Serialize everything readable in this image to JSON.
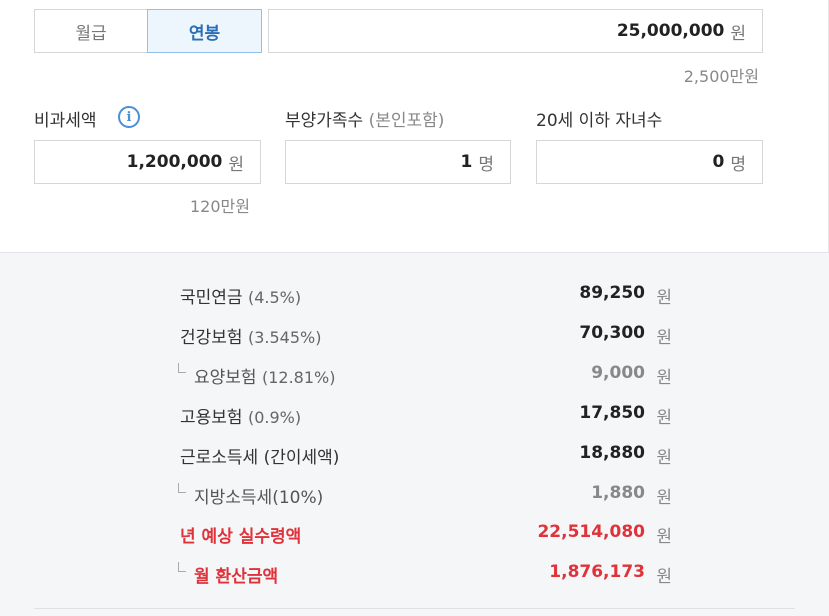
{
  "pay_type_tabs": [
    {
      "label": "월급",
      "selected": false
    },
    {
      "label": "연봉",
      "selected": true
    }
  ],
  "salary": {
    "value": "25,000,000",
    "unit": "원",
    "hint": "2,500만원"
  },
  "nontax": {
    "label": "비과세액",
    "info_icon": "info-icon",
    "value": "1,200,000",
    "unit": "원",
    "hint": "120만원"
  },
  "dependents": {
    "label": "부양가족수",
    "label_sub": "(본인포함)",
    "value": "1",
    "unit": "명"
  },
  "children": {
    "label": "20세 이하 자녀수",
    "value": "0",
    "unit": "명"
  },
  "results": {
    "pension": {
      "name": "국민연금",
      "rate": "(4.5%)",
      "amount": "89,250",
      "unit": "원"
    },
    "health": {
      "name": "건강보험",
      "rate": "(3.545%)",
      "amount": "70,300",
      "unit": "원"
    },
    "care": {
      "name": "요양보험",
      "rate": "(12.81%)",
      "amount": "9,000",
      "unit": "원"
    },
    "employment": {
      "name": "고용보험",
      "rate": "(0.9%)",
      "amount": "17,850",
      "unit": "원"
    },
    "income_tax": {
      "name": "근로소득세",
      "rate": "(간이세액)",
      "amount": "18,880",
      "unit": "원"
    },
    "local_tax": {
      "name": "지방소득세(10%)",
      "rate": "",
      "amount": "1,880",
      "unit": "원"
    },
    "annual_net": {
      "name": "년 예상 실수령액",
      "amount": "22,514,080",
      "unit": "원"
    },
    "monthly_net": {
      "name": "월 환산금액",
      "amount": "1,876,173",
      "unit": "원"
    }
  },
  "colors": {
    "accent_blue": "#2a6fb5",
    "highlight_red": "#e0323a"
  }
}
